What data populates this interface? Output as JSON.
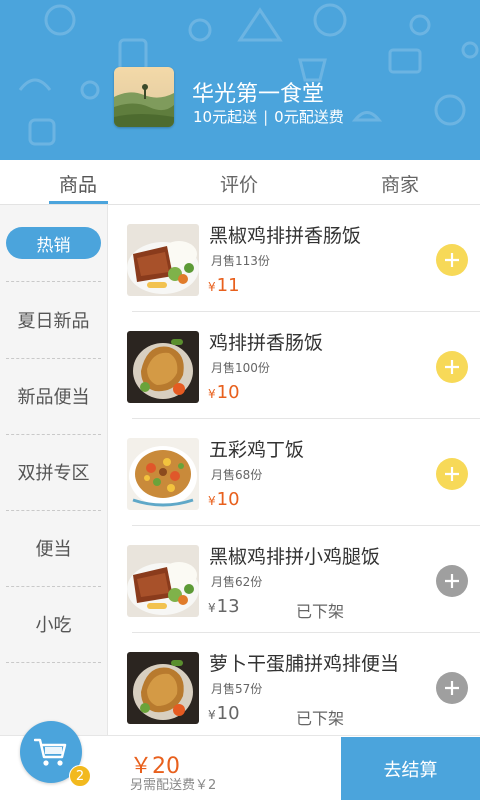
{
  "store": {
    "name": "华光第一食堂",
    "min_order": "10元起送",
    "separator": "|",
    "delivery_fee": "0元配送费"
  },
  "tabs": [
    {
      "label": "商品",
      "active": true
    },
    {
      "label": "评价",
      "active": false
    },
    {
      "label": "商家",
      "active": false
    }
  ],
  "categories": [
    {
      "label": "热销",
      "selected": true
    },
    {
      "label": "夏日新品",
      "selected": false
    },
    {
      "label": "新品便当",
      "selected": false
    },
    {
      "label": "双拼专区",
      "selected": false
    },
    {
      "label": "便当",
      "selected": false
    },
    {
      "label": "小吃",
      "selected": false
    }
  ],
  "products": [
    {
      "name": "黑椒鸡排拼香肠饭",
      "sales": "月售113份",
      "currency": "¥",
      "price": "11",
      "status": "",
      "available": true,
      "photo": "steak-rice-photo"
    },
    {
      "name": "鸡排拼香肠饭",
      "sales": "月售100份",
      "currency": "¥",
      "price": "10",
      "status": "",
      "available": true,
      "photo": "chicken-photo"
    },
    {
      "name": "五彩鸡丁饭",
      "sales": "月售68份",
      "currency": "¥",
      "price": "10",
      "status": "",
      "available": true,
      "photo": "diced-chicken-photo"
    },
    {
      "name": "黑椒鸡排拼小鸡腿饭",
      "sales": "月售62份",
      "currency": "¥",
      "price": "13",
      "status": "已下架",
      "available": false,
      "photo": "steak-rice-photo"
    },
    {
      "name": "萝卜干蛋脯拼鸡排便当",
      "sales": "月售57份",
      "currency": "¥",
      "price": "10",
      "status": "已下架",
      "available": false,
      "photo": "chicken-photo"
    }
  ],
  "cart": {
    "count": "2",
    "total": "￥20",
    "delivery_note": "另需配送费￥2",
    "checkout_label": "去结算"
  },
  "colors": {
    "primary": "#4ba4dc",
    "price": "#e8601d",
    "add_button": "#f7d958",
    "add_button_disabled": "#9f9f9f",
    "badge": "#f2b91e"
  },
  "icons": {
    "cart": "shopping-cart-icon",
    "add": "plus-icon"
  }
}
